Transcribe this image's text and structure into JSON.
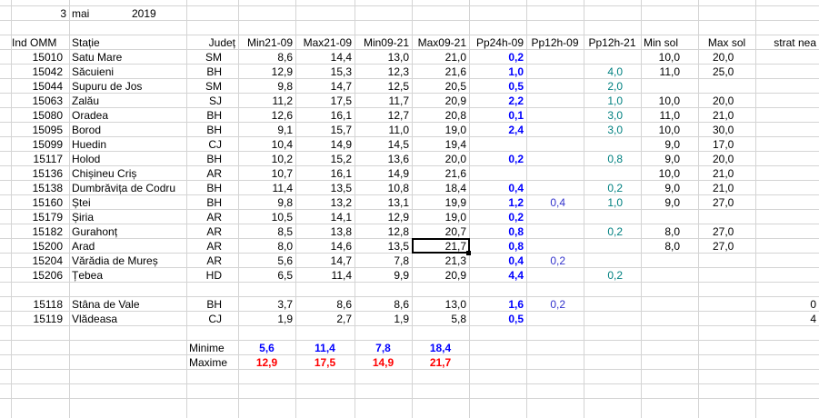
{
  "date": {
    "day": "3",
    "month": "mai",
    "year": "2019"
  },
  "headers": [
    "Ind OMM",
    "Stație",
    "Județ",
    "Min21-09",
    "Max21-09",
    "Min09-21",
    "Max09-21",
    "Pp24h-09",
    "Pp12h-09",
    "Pp12h-21",
    "Min sol",
    "Max sol",
    "strat nea"
  ],
  "rows": [
    [
      "15010",
      "Satu Mare",
      "SM",
      "8,6",
      "14,4",
      "13,0",
      "21,0",
      "0,2",
      "",
      "",
      "10,0",
      "20,0",
      ""
    ],
    [
      "15042",
      "Săcuieni",
      "BH",
      "12,9",
      "15,3",
      "12,3",
      "21,6",
      "1,0",
      "",
      "4,0",
      "11,0",
      "25,0",
      ""
    ],
    [
      "15044",
      "Supuru de Jos",
      "SM",
      "9,8",
      "14,7",
      "12,5",
      "20,5",
      "0,5",
      "",
      "2,0",
      "",
      "",
      ""
    ],
    [
      "15063",
      "Zalău",
      "SJ",
      "11,2",
      "17,5",
      "11,7",
      "20,9",
      "2,2",
      "",
      "1,0",
      "10,0",
      "20,0",
      ""
    ],
    [
      "15080",
      "Oradea",
      "BH",
      "12,6",
      "16,1",
      "12,7",
      "20,8",
      "0,1",
      "",
      "3,0",
      "11,0",
      "21,0",
      ""
    ],
    [
      "15095",
      "Borod",
      "BH",
      "9,1",
      "15,7",
      "11,0",
      "19,0",
      "2,4",
      "",
      "3,0",
      "10,0",
      "30,0",
      ""
    ],
    [
      "15099",
      "Huedin",
      "CJ",
      "10,4",
      "14,9",
      "14,5",
      "19,4",
      "",
      "",
      "",
      "9,0",
      "17,0",
      ""
    ],
    [
      "15117",
      "Holod",
      "BH",
      "10,2",
      "15,2",
      "13,6",
      "20,0",
      "0,2",
      "",
      "0,8",
      "9,0",
      "20,0",
      ""
    ],
    [
      "15136",
      "Chișineu    Criș",
      "AR",
      "10,7",
      "16,1",
      "14,9",
      "21,6",
      "",
      "",
      "",
      "10,0",
      "21,0",
      ""
    ],
    [
      "15138",
      "Dumbrăvița de Codru",
      "BH",
      "11,4",
      "13,5",
      "10,8",
      "18,4",
      "0,4",
      "",
      "0,2",
      "9,0",
      "21,0",
      ""
    ],
    [
      "15160",
      "Ștei",
      "BH",
      "9,8",
      "13,2",
      "13,1",
      "19,9",
      "1,2",
      "0,4",
      "1,0",
      "9,0",
      "27,0",
      ""
    ],
    [
      "15179",
      "Șiria",
      "AR",
      "10,5",
      "14,1",
      "12,9",
      "19,0",
      "0,2",
      "",
      "",
      "",
      "",
      ""
    ],
    [
      "15182",
      "Gurahonț",
      "AR",
      "8,5",
      "13,8",
      "12,8",
      "20,7",
      "0,8",
      "",
      "0,2",
      "8,0",
      "27,0",
      ""
    ],
    [
      "15200",
      "Arad",
      "AR",
      "8,0",
      "14,6",
      "13,5",
      "21,7",
      "0,8",
      "",
      "",
      "8,0",
      "27,0",
      ""
    ],
    [
      "15204",
      "Vărădia de Mureș",
      "AR",
      "5,6",
      "14,7",
      "7,8",
      "21,3",
      "0,4",
      "0,2",
      "",
      "",
      "",
      ""
    ],
    [
      "15206",
      "Țebea",
      "HD",
      "6,5",
      "11,4",
      "9,9",
      "20,9",
      "4,4",
      "",
      "0,2",
      "",
      "",
      ""
    ],
    [
      "",
      "",
      "",
      "",
      "",
      "",
      "",
      "",
      "",
      "",
      "",
      "",
      ""
    ],
    [
      "15118",
      "Stâna de Vale",
      "BH",
      "3,7",
      "8,6",
      "8,6",
      "13,0",
      "1,6",
      "0,2",
      "",
      "",
      "",
      "0"
    ],
    [
      "15119",
      "Vlădeasa",
      "CJ",
      "1,9",
      "2,7",
      "1,9",
      "5,8",
      "0,5",
      "",
      "",
      "",
      "",
      "4"
    ]
  ],
  "summary": {
    "min_label": "Minime",
    "max_label": "Maxime",
    "min_values": [
      "5,6",
      "11,4",
      "7,8",
      "18,4"
    ],
    "max_values": [
      "12,9",
      "17,5",
      "14,9",
      "21,7"
    ]
  },
  "colors": {
    "grid": "#d4d4d4",
    "precip_24h": "#0000ff",
    "precip_12h_09": "#3333cc",
    "precip_12h_21": "#008080",
    "summary_min": "#0000ff",
    "summary_max": "#ff0000"
  },
  "selected_cell": "Max09-21 / 15200"
}
